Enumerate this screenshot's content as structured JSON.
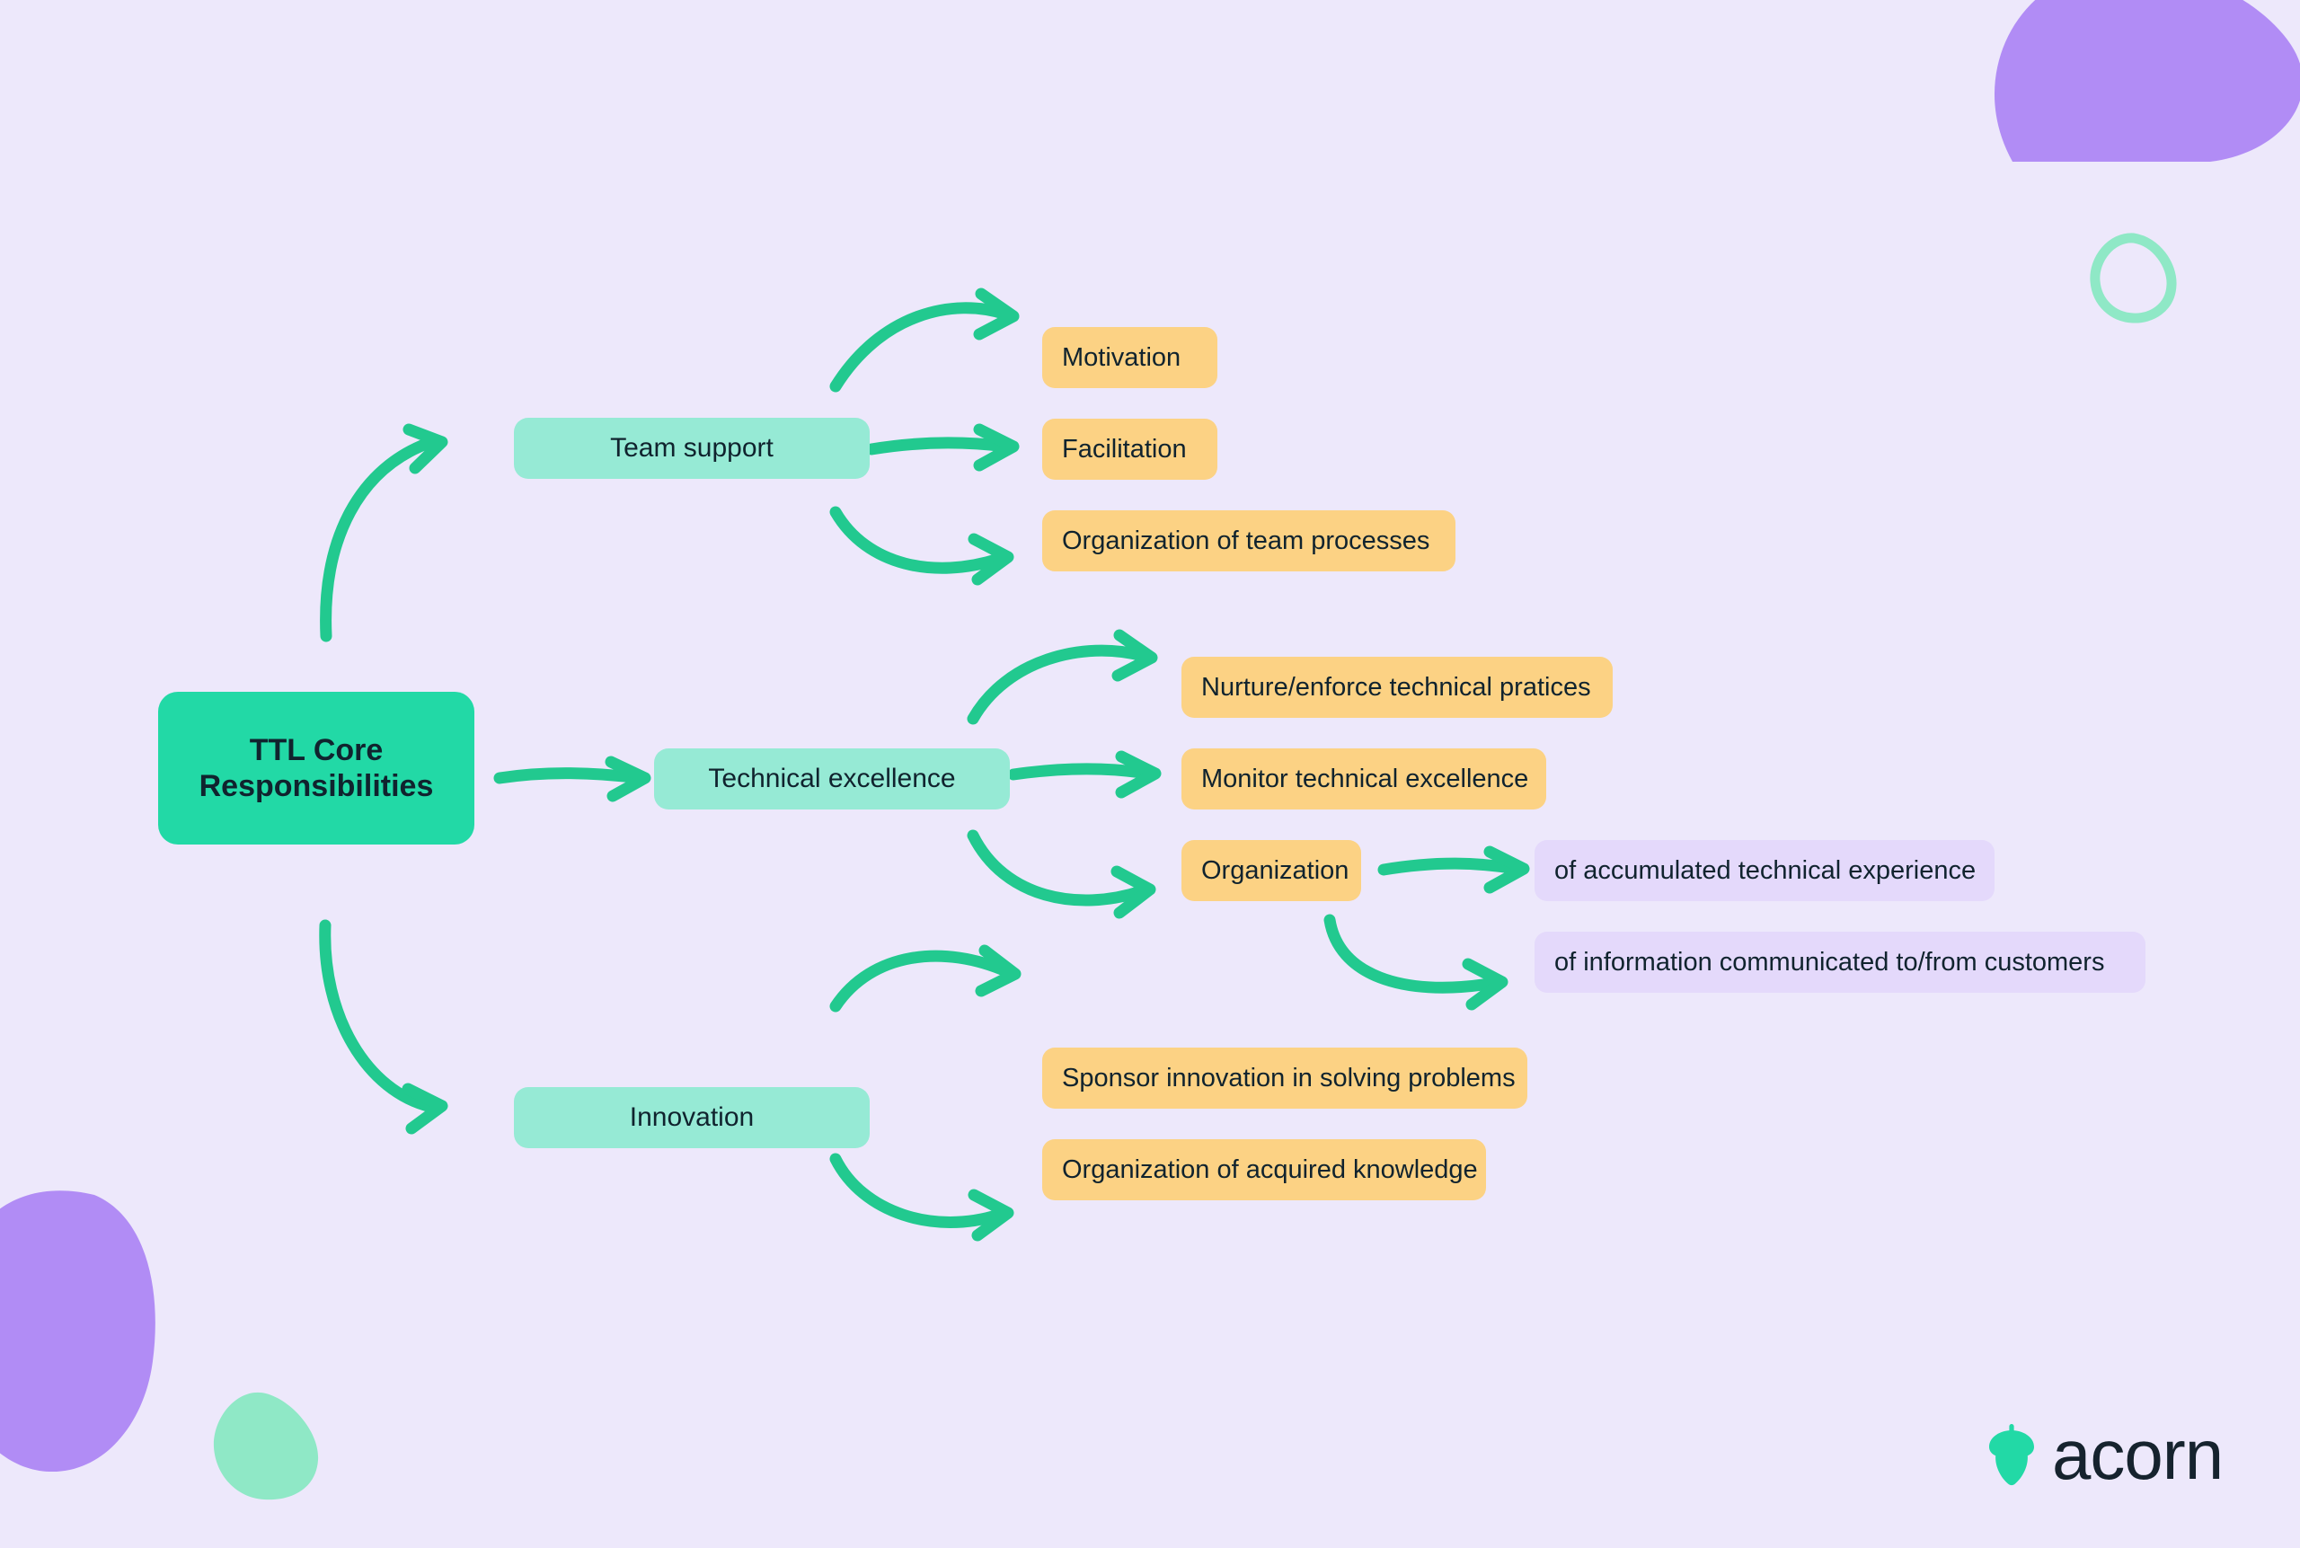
{
  "palette": {
    "background": "#EDE8FB",
    "root_fill": "#22D9A6",
    "branch_fill": "#96EAD5",
    "leaf_fill": "#FCD284",
    "subleaf_fill": "#E4D9FB",
    "arrow": "#22C98F",
    "text_dark": "#10232E",
    "blob_purple": "#B18CF5",
    "blob_mint": "#8FE8C6"
  },
  "diagram": {
    "type": "mind-map",
    "root": {
      "line1": "TTL Core",
      "line2": "Responsibilities"
    },
    "branches": [
      {
        "label": "Team support",
        "leaves": [
          {
            "label": "Motivation",
            "children": []
          },
          {
            "label": "Facilitation",
            "children": []
          },
          {
            "label": "Organization of team processes",
            "children": []
          }
        ]
      },
      {
        "label": "Technical excellence",
        "leaves": [
          {
            "label": "Nurture/enforce technical pratices",
            "children": []
          },
          {
            "label": "Monitor technical excellence",
            "children": []
          },
          {
            "label": "Organization",
            "children": [
              {
                "label": "of accumulated technical experience"
              },
              {
                "label": "of information communicated to/from customers"
              }
            ]
          }
        ]
      },
      {
        "label": "Innovation",
        "leaves": [
          {
            "label": "Sponsor innovation in solving problems",
            "children": []
          },
          {
            "label": "Organization of acquired knowledge",
            "children": []
          }
        ]
      }
    ]
  },
  "logo": {
    "text": "acorn",
    "icon": "acorn-icon"
  }
}
